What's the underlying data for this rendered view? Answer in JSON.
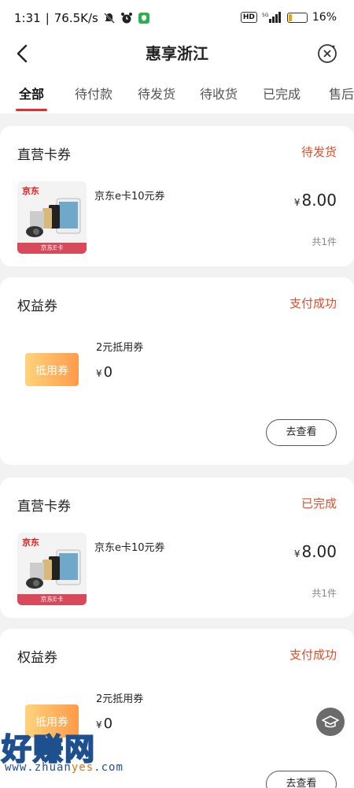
{
  "status_bar": {
    "time": "1:31",
    "speed": "76.5K/s",
    "hd": "HD",
    "network": "5G",
    "battery": "16%"
  },
  "nav": {
    "title": "惠享浙江"
  },
  "tabs": [
    "全部",
    "待付款",
    "待发货",
    "待收货",
    "已完成",
    "售后"
  ],
  "orders": [
    {
      "title": "直营卡券",
      "status": "待发货",
      "thumb_brand": "京东",
      "thumb_band": "京东E卡",
      "item_name": "京东e卡10元券",
      "price_symbol": "¥",
      "price": "8.00",
      "count": "共1件"
    },
    {
      "title": "权益券",
      "status": "支付成功",
      "coupon_label": "抵用券",
      "item_name": "2元抵用券",
      "price_symbol": "¥",
      "price": "0",
      "button": "去查看"
    },
    {
      "title": "直营卡券",
      "status": "已完成",
      "thumb_brand": "京东",
      "thumb_band": "京东E卡",
      "item_name": "京东e卡10元券",
      "price_symbol": "¥",
      "price": "8.00",
      "count": "共1件"
    },
    {
      "title": "权益券",
      "status": "支付成功",
      "coupon_label": "抵用券",
      "item_name": "2元抵用券",
      "price_symbol": "¥",
      "price": "0",
      "button": "去查看"
    }
  ],
  "watermark": {
    "big": "好赚网",
    "small_a": "www.zhuan",
    "small_b": "yes",
    "small_c": ".com"
  },
  "colors": {
    "accent": "#e0302a",
    "status": "#e0502a"
  }
}
